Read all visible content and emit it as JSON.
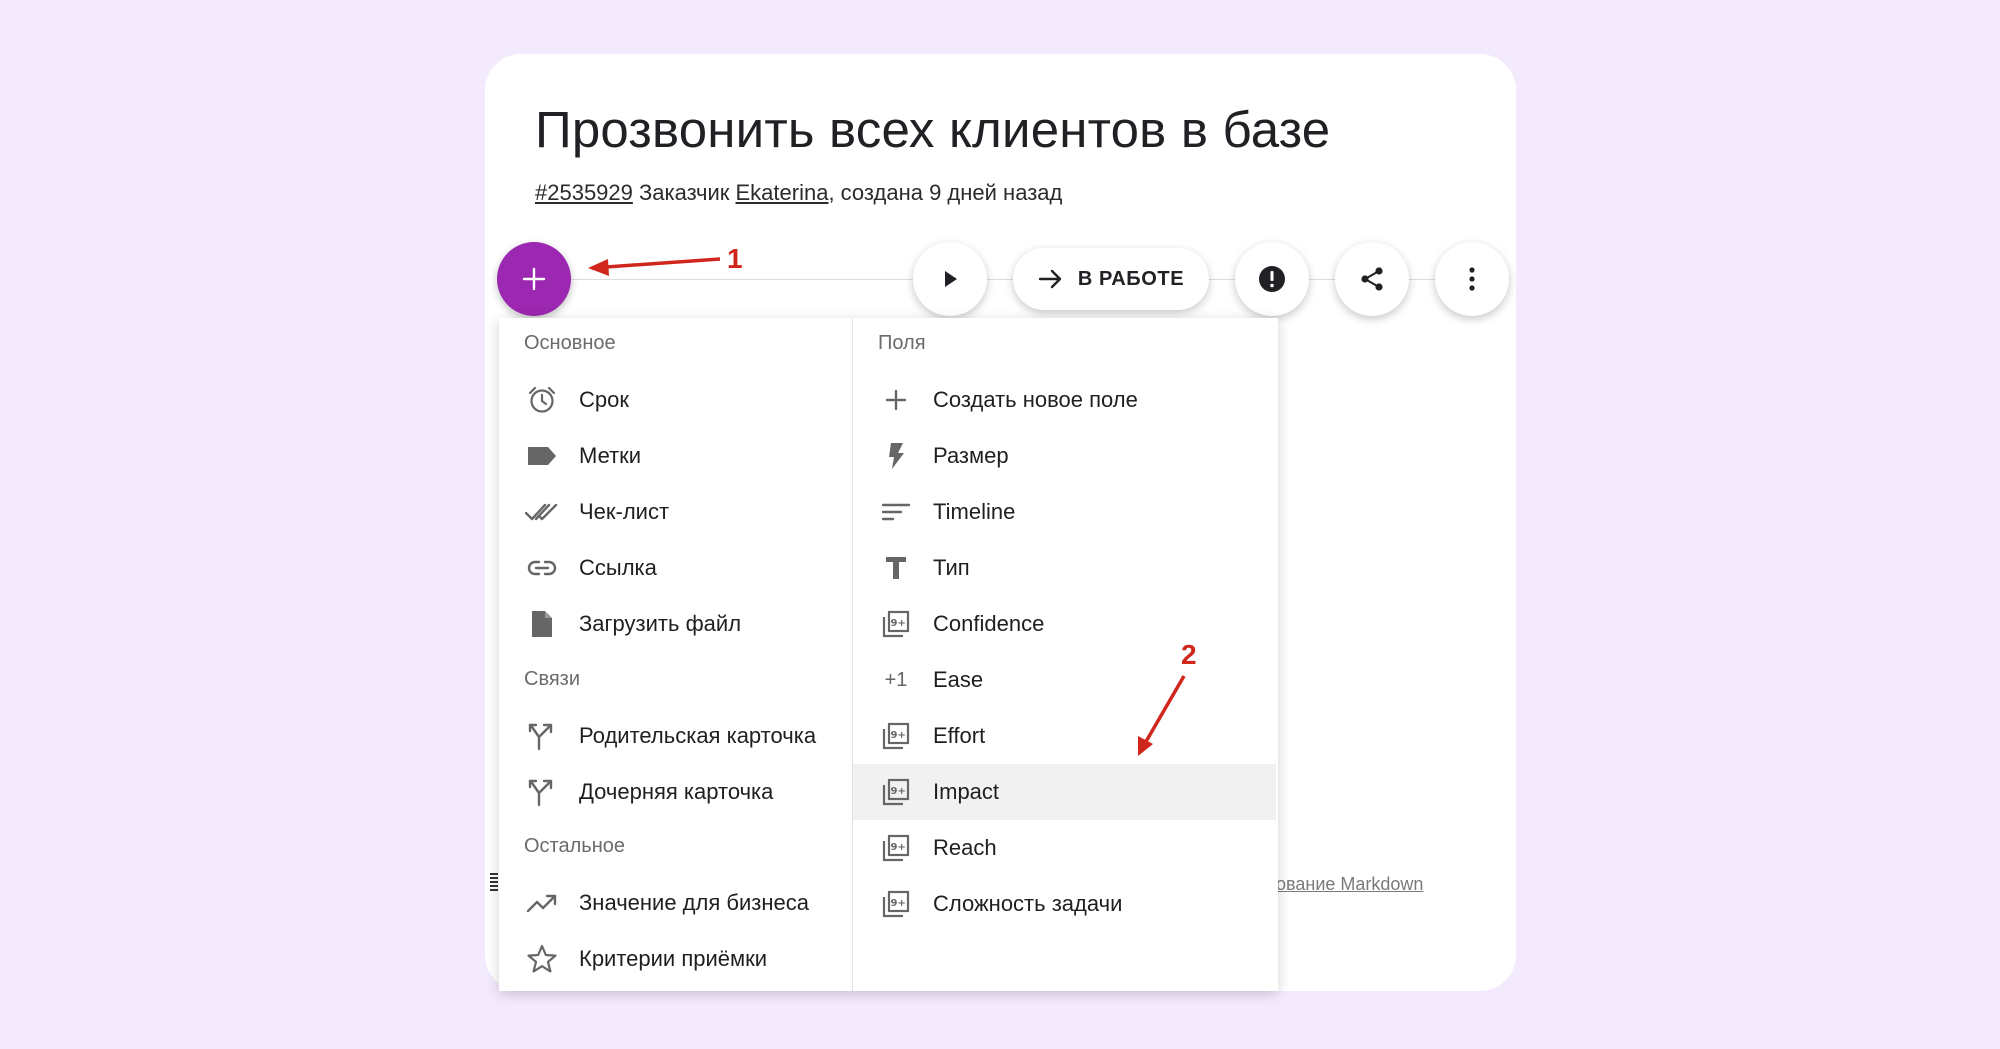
{
  "card": {
    "title": "Прозвонить всех клиентов в базе",
    "meta": {
      "id": "#2535929",
      "customer_prefix": "Заказчик",
      "customer": "Ekaterina",
      "created": ", создана 9 дней назад"
    },
    "status_label": "В РАБОТЕ",
    "markdown_link": "ование Markdown"
  },
  "menu": {
    "left": {
      "sections": [
        {
          "label": "Основное",
          "items": [
            {
              "label": "Срок",
              "icon": "alarm-clock-icon"
            },
            {
              "label": "Метки",
              "icon": "label-tag-icon"
            },
            {
              "label": "Чек-лист",
              "icon": "double-check-icon"
            },
            {
              "label": "Ссылка",
              "icon": "link-icon"
            },
            {
              "label": "Загрузить файл",
              "icon": "file-icon"
            }
          ]
        },
        {
          "label": "Связи",
          "items": [
            {
              "label": "Родительская карточка",
              "icon": "fork-arrow-icon"
            },
            {
              "label": "Дочерняя карточка",
              "icon": "fork-arrow-icon"
            }
          ]
        },
        {
          "label": "Остальное",
          "items": [
            {
              "label": "Значение для бизнеса",
              "icon": "trending-up-icon"
            },
            {
              "label": "Критерии приёмки",
              "icon": "star-outline-icon"
            }
          ]
        }
      ]
    },
    "right": {
      "label": "Поля",
      "items": [
        {
          "label": "Создать новое поле",
          "icon": "plus-icon"
        },
        {
          "label": "Размер",
          "icon": "bolt-icon"
        },
        {
          "label": "Timeline",
          "icon": "sort-lines-icon"
        },
        {
          "label": "Тип",
          "icon": "text-t-icon"
        },
        {
          "label": "Confidence",
          "icon": "filter-9-plus-icon"
        },
        {
          "label": "Ease",
          "icon": "plus-one-icon",
          "glyph": "+1"
        },
        {
          "label": "Effort",
          "icon": "filter-9-plus-icon"
        },
        {
          "label": "Impact",
          "icon": "filter-9-plus-icon",
          "highlighted": true
        },
        {
          "label": "Reach",
          "icon": "filter-9-plus-icon"
        },
        {
          "label": "Сложность задачи",
          "icon": "filter-9-plus-icon"
        }
      ]
    }
  },
  "annotations": {
    "arrow1_label": "1",
    "arrow2_label": "2",
    "color": "#d0271d"
  },
  "colors": {
    "background": "#f3eafd",
    "fab": "#9c27b0",
    "highlight": "#f1f1f1"
  }
}
